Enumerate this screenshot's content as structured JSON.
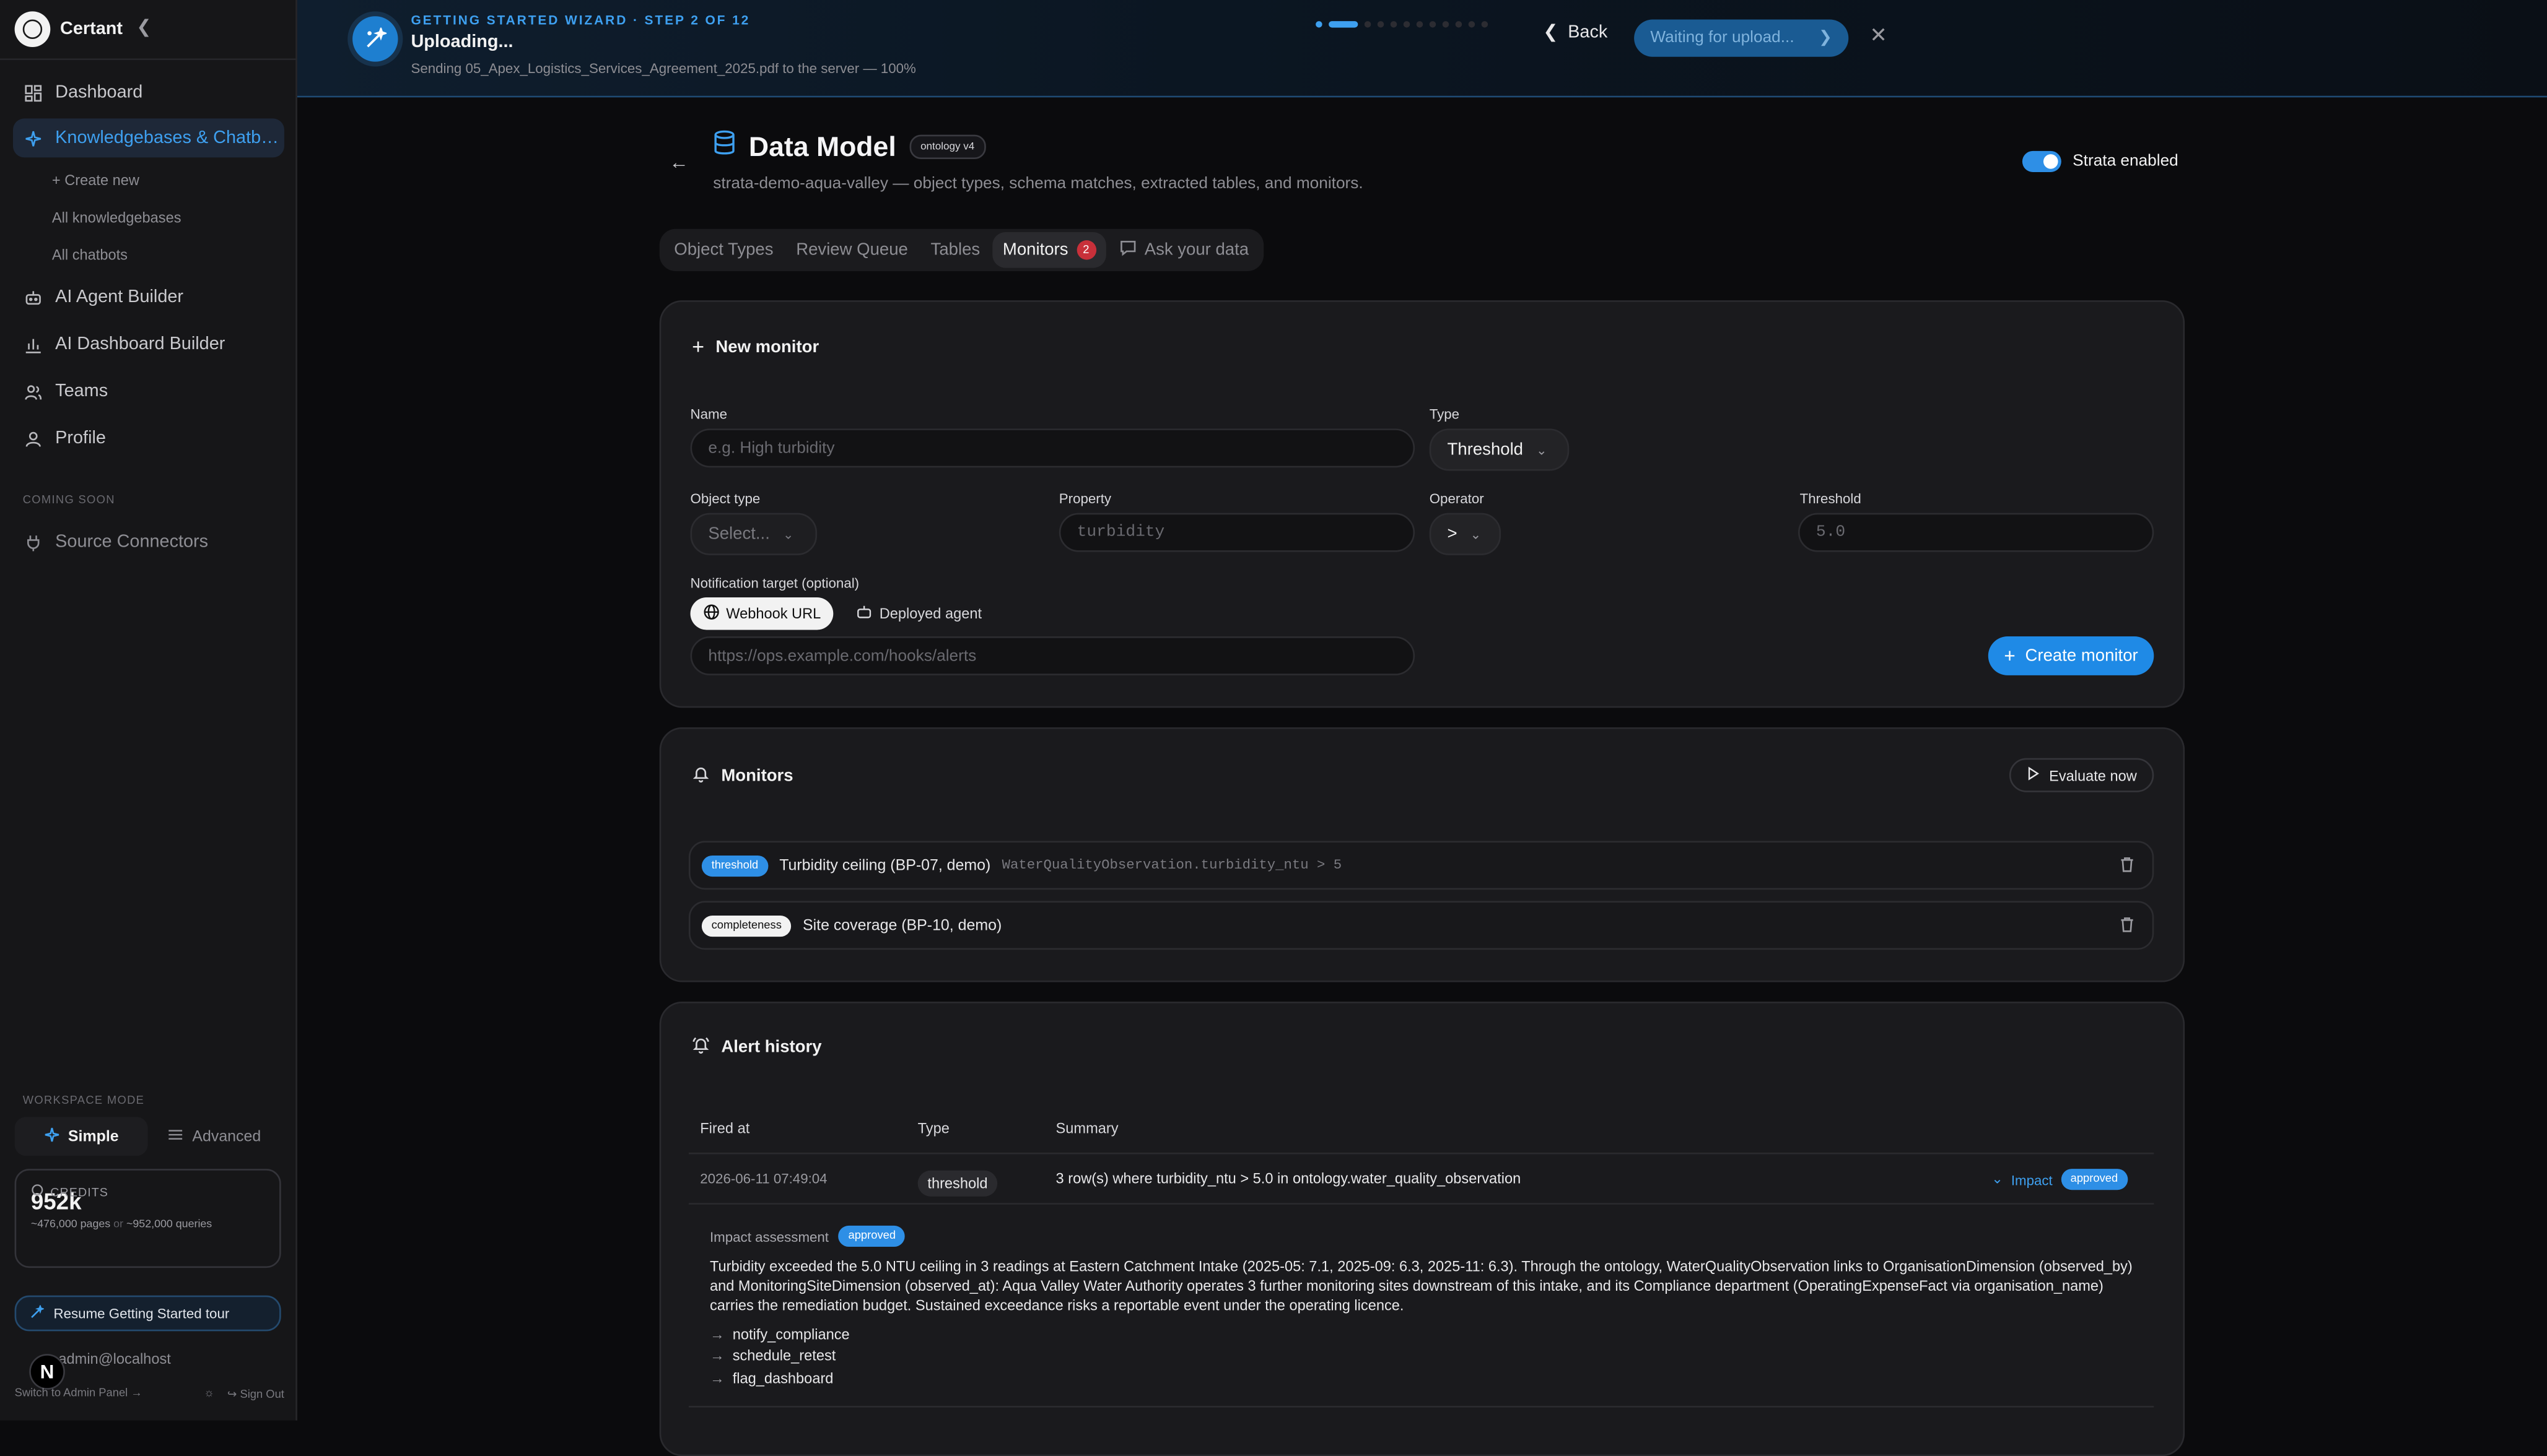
{
  "sidebar": {
    "brand": "Certant",
    "nav": [
      {
        "label": "Dashboard",
        "icon": "grid-icon"
      },
      {
        "label": "Knowledgebases & Chatb…",
        "icon": "sparkle-icon",
        "active": true
      },
      {
        "label": "AI Agent Builder",
        "icon": "bot-icon"
      },
      {
        "label": "AI Dashboard Builder",
        "icon": "bar-chart-icon"
      },
      {
        "label": "Teams",
        "icon": "users-icon"
      },
      {
        "label": "Profile",
        "icon": "user-icon"
      }
    ],
    "sub_items": [
      "+ Create new",
      "All knowledgebases",
      "All chatbots"
    ],
    "coming_soon_label": "COMING SOON",
    "source_connectors": "Source Connectors",
    "workspace_mode_label": "WORKSPACE MODE",
    "mode_simple": "Simple",
    "mode_advanced": "Advanced",
    "credits": {
      "label": "CREDITS",
      "value": "952k",
      "pages": "~476,000 pages",
      "or": "or",
      "queries": "~952,000 queries"
    },
    "resume_tour": "Resume Getting Started tour",
    "user_email": "admin@localhost",
    "avatar_letter": "N",
    "switch_admin": "Switch to Admin Panel →",
    "sign_out": "Sign Out"
  },
  "wizard": {
    "step": "GETTING STARTED WIZARD · STEP 2 OF 12",
    "title": "Uploading...",
    "subtitle": "Sending 05_Apex_Logistics_Services_Agreement_2025.pdf to the server — 100%",
    "steps_total": 12,
    "current_step": 2,
    "back": "Back",
    "waiting": "Waiting for upload..."
  },
  "page": {
    "title": "Data Model",
    "ontology_chip": "ontology v4",
    "subtitle": "strata-demo-aqua-valley — object types, schema matches, extracted tables, and monitors.",
    "strata_toggle": "Strata enabled",
    "tabs": [
      "Object Types",
      "Review Queue",
      "Tables",
      "Monitors",
      "Ask your data"
    ],
    "monitors_badge": "2"
  },
  "new_monitor": {
    "heading": "New monitor",
    "name_label": "Name",
    "name_placeholder": "e.g. High turbidity",
    "type_label": "Type",
    "type_value": "Threshold",
    "object_type_label": "Object type",
    "object_type_value": "Select...",
    "property_label": "Property",
    "property_placeholder": "turbidity",
    "operator_label": "Operator",
    "operator_value": ">",
    "threshold_label": "Threshold",
    "threshold_placeholder": "5.0",
    "notification_label": "Notification target (optional)",
    "webhook": "Webhook URL",
    "deployed_agent": "Deployed agent",
    "url_placeholder": "https://ops.example.com/hooks/alerts",
    "create": "Create monitor"
  },
  "monitors": {
    "heading": "Monitors",
    "evaluate": "Evaluate now",
    "rows": [
      {
        "tag": "threshold",
        "name": "Turbidity ceiling (BP-07, demo)",
        "expr": "WaterQualityObservation.turbidity_ntu > 5"
      },
      {
        "tag": "completeness",
        "name": "Site coverage (BP-10, demo)",
        "expr": ""
      }
    ]
  },
  "alerts": {
    "heading": "Alert history",
    "columns": [
      "Fired at",
      "Type",
      "Summary"
    ],
    "row": {
      "fired_at": "2026-06-11 07:49:04",
      "type": "threshold",
      "summary": "3 row(s) where turbidity_ntu > 5.0 in ontology.water_quality_observation",
      "impact": "Impact",
      "status": "approved"
    },
    "assessment": {
      "label": "Impact assessment",
      "status": "approved",
      "text": "Turbidity exceeded the 5.0 NTU ceiling in 3 readings at Eastern Catchment Intake (2025-05: 7.1, 2025-09: 6.3, 2025-11: 6.3). Through the ontology, WaterQualityObservation links to OrganisationDimension (observed_by) and MonitoringSiteDimension (observed_at): Aqua Valley Water Authority operates 3 further monitoring sites downstream of this intake, and its Compliance department (OperatingExpenseFact via organisation_name) carries the remediation budget. Sustained exceedance risks a reportable event under the operating licence.",
      "actions": [
        "notify_compliance",
        "schedule_retest",
        "flag_dashboard"
      ]
    }
  },
  "colors": {
    "accent": "#2e8fe6",
    "badge": "#c8303a",
    "bg": "#0b0b0d",
    "card": "#1a1a1d"
  }
}
